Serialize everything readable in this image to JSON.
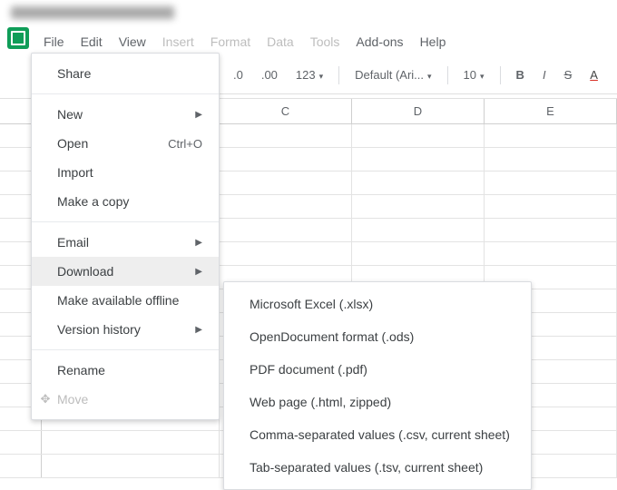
{
  "menubar": {
    "file": "File",
    "edit": "Edit",
    "view": "View",
    "insert": "Insert",
    "format": "Format",
    "data": "Data",
    "tools": "Tools",
    "addons": "Add-ons",
    "help": "Help"
  },
  "toolbar": {
    "dec0": ".0",
    "dec00": ".00",
    "numfmt": "123",
    "font": "Default (Ari...",
    "size": "10",
    "bold": "B",
    "italic": "I",
    "strike": "S",
    "color": "A"
  },
  "columns": [
    "C",
    "D",
    "E"
  ],
  "file_menu": {
    "share": "Share",
    "new": "New",
    "open": "Open",
    "open_shortcut": "Ctrl+O",
    "import": "Import",
    "make_copy": "Make a copy",
    "email": "Email",
    "download": "Download",
    "make_offline": "Make available offline",
    "version_history": "Version history",
    "rename": "Rename",
    "move": "Move"
  },
  "download_menu": {
    "xlsx": "Microsoft Excel (.xlsx)",
    "ods": "OpenDocument format (.ods)",
    "pdf": "PDF document (.pdf)",
    "html": "Web page (.html, zipped)",
    "csv": "Comma-separated values (.csv, current sheet)",
    "tsv": "Tab-separated values (.tsv, current sheet)"
  }
}
